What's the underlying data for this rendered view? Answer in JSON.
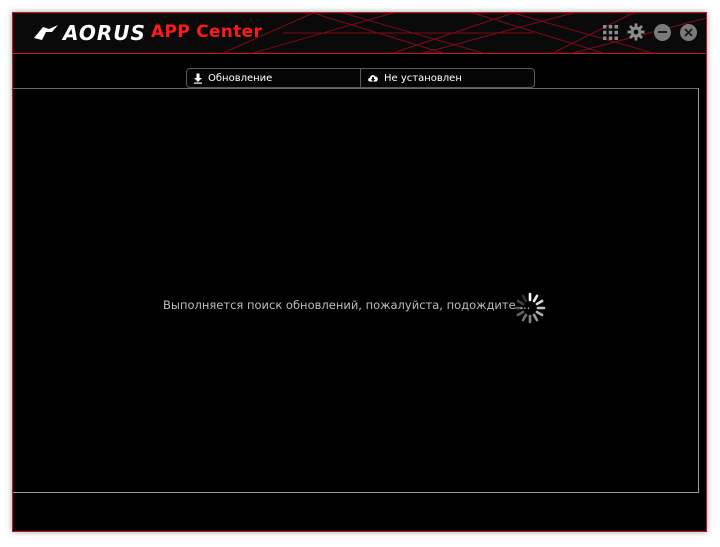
{
  "window": {
    "brand": "AORUS",
    "title": "APP Center"
  },
  "tabs": [
    {
      "label": "Обновление",
      "icon": "download-icon"
    },
    {
      "label": "Не установлен",
      "icon": "cloud-download-icon"
    }
  ],
  "main": {
    "status_text": "Выполняется поиск обновлений, пожалуйста, подождите ..."
  },
  "controls": {
    "icons": [
      "grid-icon",
      "gear-icon",
      "minimize-icon",
      "close-icon"
    ]
  },
  "colors": {
    "accent": "#ff1a1a",
    "border": "#c8102e",
    "background": "#000000"
  }
}
